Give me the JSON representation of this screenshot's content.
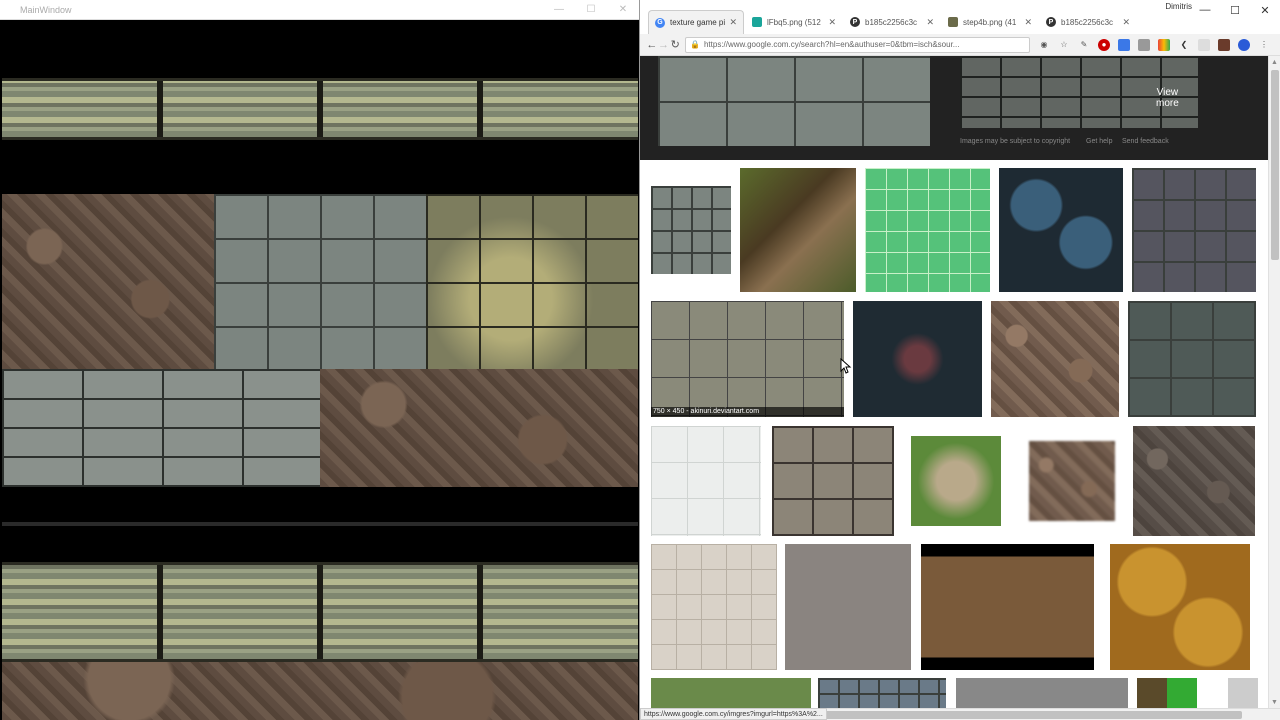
{
  "left_window": {
    "title": "MainWindow",
    "controls": {
      "minimize": "—",
      "maximize": "☐",
      "close": "✕"
    }
  },
  "browser": {
    "user": "Dimitris",
    "tabs": [
      {
        "label": "texture game pi",
        "favicon": "G",
        "favicon_color": "#4285f4",
        "active": true
      },
      {
        "label": "lFbq5.png (512",
        "favicon": "",
        "favicon_color": "#1aa59a",
        "active": false
      },
      {
        "label": "b185c2256c3c",
        "favicon": "P",
        "favicon_color": "#333333",
        "active": false
      },
      {
        "label": "step4b.png (41",
        "favicon": "",
        "favicon_color": "#6b6b4a",
        "active": false
      },
      {
        "label": "b185c2256c3c",
        "favicon": "P",
        "favicon_color": "#333333",
        "active": false
      }
    ],
    "window_controls": {
      "minimize": "—",
      "maximize": "☐",
      "close": "✕"
    },
    "url": "https://www.google.com.cy/search?hl=en&authuser=0&tbm=isch&sour...",
    "view_more": [
      "View",
      "more"
    ],
    "feedback_links": [
      "Images may be subject to copyright",
      "Get help",
      "Send feedback"
    ],
    "thumbnail_caption": "750 × 450 - akinuri.deviantart.com",
    "status_url": "https://www.google.com.cy/imgres?imgurl=https%3A%2..."
  },
  "colors": {
    "accent": "#4285f4",
    "dark_panel": "#222222"
  }
}
